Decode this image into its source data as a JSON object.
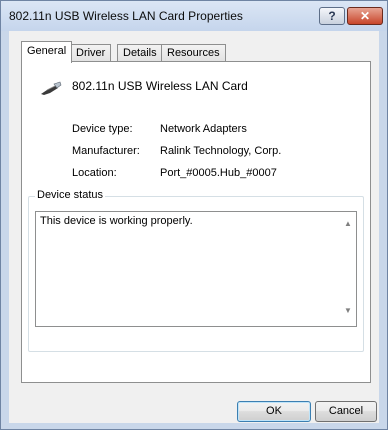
{
  "window": {
    "title": "802.11n USB Wireless LAN Card Properties",
    "help_glyph": "?",
    "close_glyph": "✕"
  },
  "tabs": [
    {
      "label": "General",
      "active": true
    },
    {
      "label": "Driver",
      "active": false
    },
    {
      "label": "Details",
      "active": false
    },
    {
      "label": "Resources",
      "active": false
    }
  ],
  "device": {
    "name": "802.11n USB Wireless LAN Card",
    "icon": "usb-wireless-adapter-icon"
  },
  "properties": [
    {
      "label": "Device type:",
      "value": "Network Adapters"
    },
    {
      "label": "Manufacturer:",
      "value": "Ralink Technology, Corp."
    },
    {
      "label": "Location:",
      "value": "Port_#0005.Hub_#0007"
    }
  ],
  "device_status": {
    "legend": "Device status",
    "text": "This device is working properly.",
    "scroll_up": "▲",
    "scroll_down": "▼"
  },
  "buttons": {
    "ok": "OK",
    "cancel": "Cancel"
  }
}
